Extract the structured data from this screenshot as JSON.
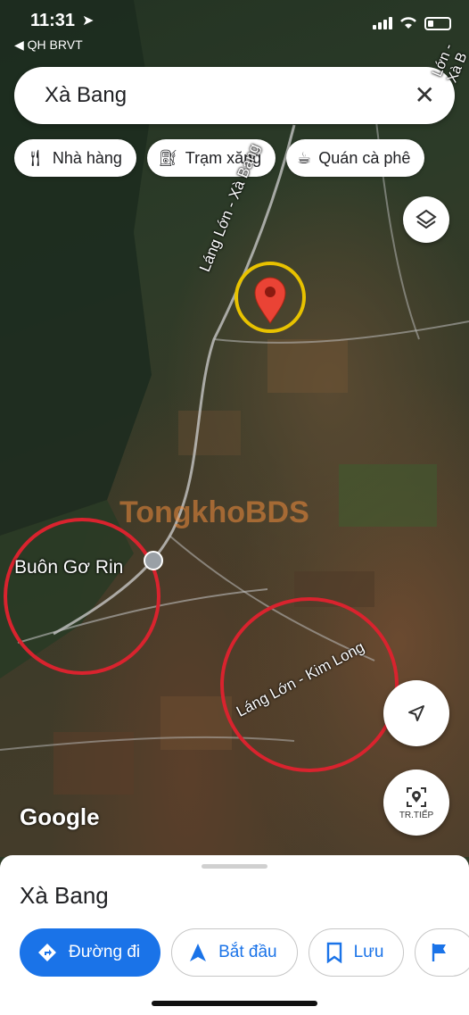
{
  "status_bar": {
    "time": "11:31",
    "back_app": "◀ QH BRVT"
  },
  "search": {
    "value": "Xà Bang",
    "clear_icon": "close-icon"
  },
  "chips": [
    {
      "label": "Nhà hàng",
      "icon": "restaurant-icon"
    },
    {
      "label": "Trạm xăng",
      "icon": "gas-station-icon"
    },
    {
      "label": "Quán cà phê",
      "icon": "coffee-icon"
    }
  ],
  "map": {
    "road_label_top": "Láng Lớn - Xà Bang",
    "road_label_top_right": "Lớn - Xà B",
    "place_label": "Buôn Gơ Rin",
    "road_label_bottom": "Láng Lớn - Kim Long",
    "watermark": "TongkhoBDS",
    "google_logo": "Google",
    "live_view_label": "TR.TIẾP",
    "accent_circle_color": "#d9232e",
    "pin_highlight_color": "#e8c200"
  },
  "sheet": {
    "title": "Xà Bang",
    "actions": [
      {
        "label": "Đường đi",
        "icon": "directions-icon"
      },
      {
        "label": "Bắt đầu",
        "icon": "navigation-arrow-icon"
      },
      {
        "label": "Lưu",
        "icon": "bookmark-icon"
      }
    ]
  },
  "colors": {
    "brand_blue": "#1a73e8",
    "pin_red": "#ea4335"
  }
}
